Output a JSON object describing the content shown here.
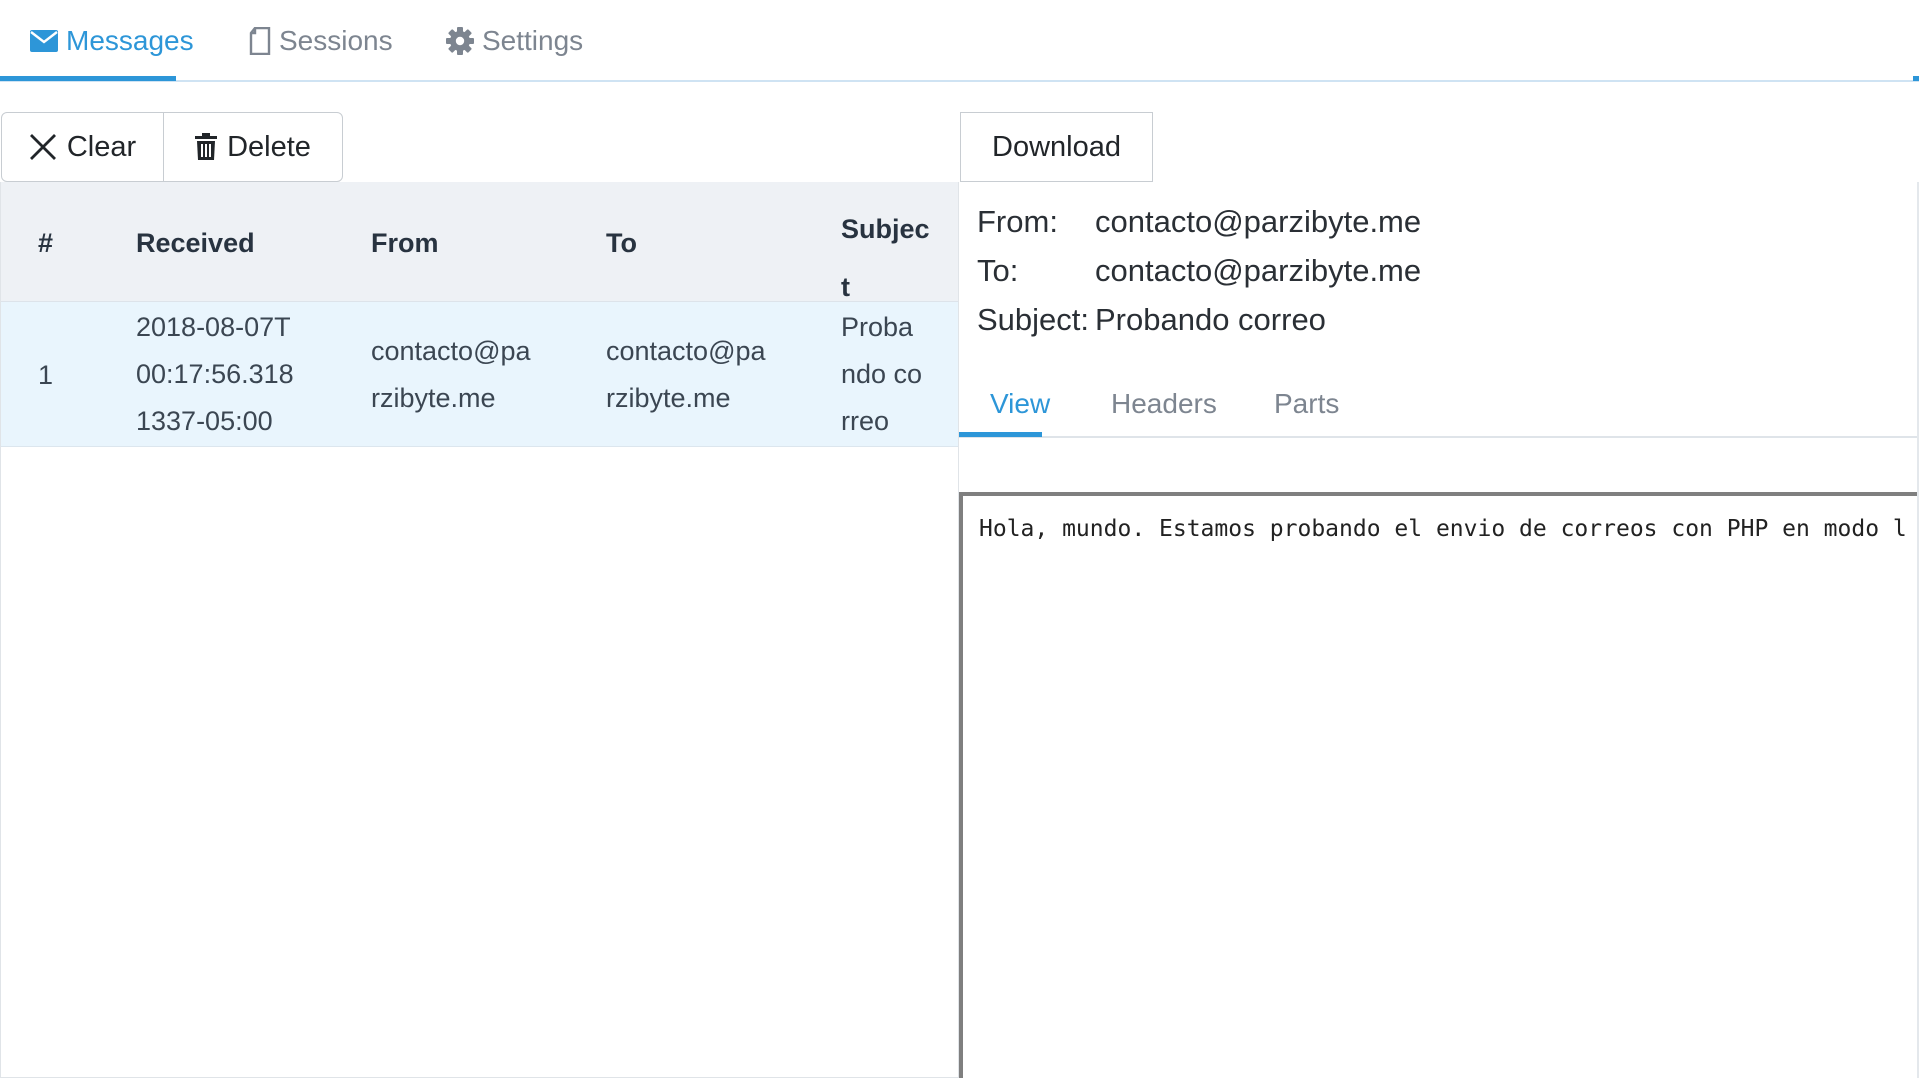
{
  "top_tabs": [
    {
      "label": "Messages",
      "icon": "envelope-icon",
      "active": true
    },
    {
      "label": "Sessions",
      "icon": "document-icon",
      "active": false
    },
    {
      "label": "Settings",
      "icon": "gear-icon",
      "active": false
    }
  ],
  "toolbar": {
    "clear_label": "Clear",
    "delete_label": "Delete",
    "download_label": "Download"
  },
  "table": {
    "columns": [
      "#",
      "Received",
      "From",
      "To",
      "Subject"
    ],
    "header_wrapped": {
      "subject_line1": "Subjec",
      "subject_line2": "t"
    },
    "rows": [
      {
        "index": "1",
        "received_lines": [
          "2018-08-07T",
          "00:17:56.318",
          "1337-05:00"
        ],
        "from_lines": [
          "contacto@pa",
          "rzibyte.me"
        ],
        "to_lines": [
          "contacto@pa",
          "rzibyte.me"
        ],
        "subject_lines": [
          "Proba",
          "ndo co",
          "rreo"
        ]
      }
    ]
  },
  "message": {
    "from_label": "From:",
    "from_value": "contacto@parzibyte.me",
    "to_label": "To:",
    "to_value": "contacto@parzibyte.me",
    "subject_label": "Subject:",
    "subject_value": "Probando correo",
    "tabs": [
      {
        "label": "View",
        "active": true
      },
      {
        "label": "Headers",
        "active": false
      },
      {
        "label": "Parts",
        "active": false
      }
    ],
    "body": "Hola, mundo. Estamos probando el envio de correos con PHP en modo l"
  },
  "colors": {
    "accent": "#2d96d8",
    "selected_row": "#e9f5fd",
    "header_bg": "#eef1f5"
  }
}
